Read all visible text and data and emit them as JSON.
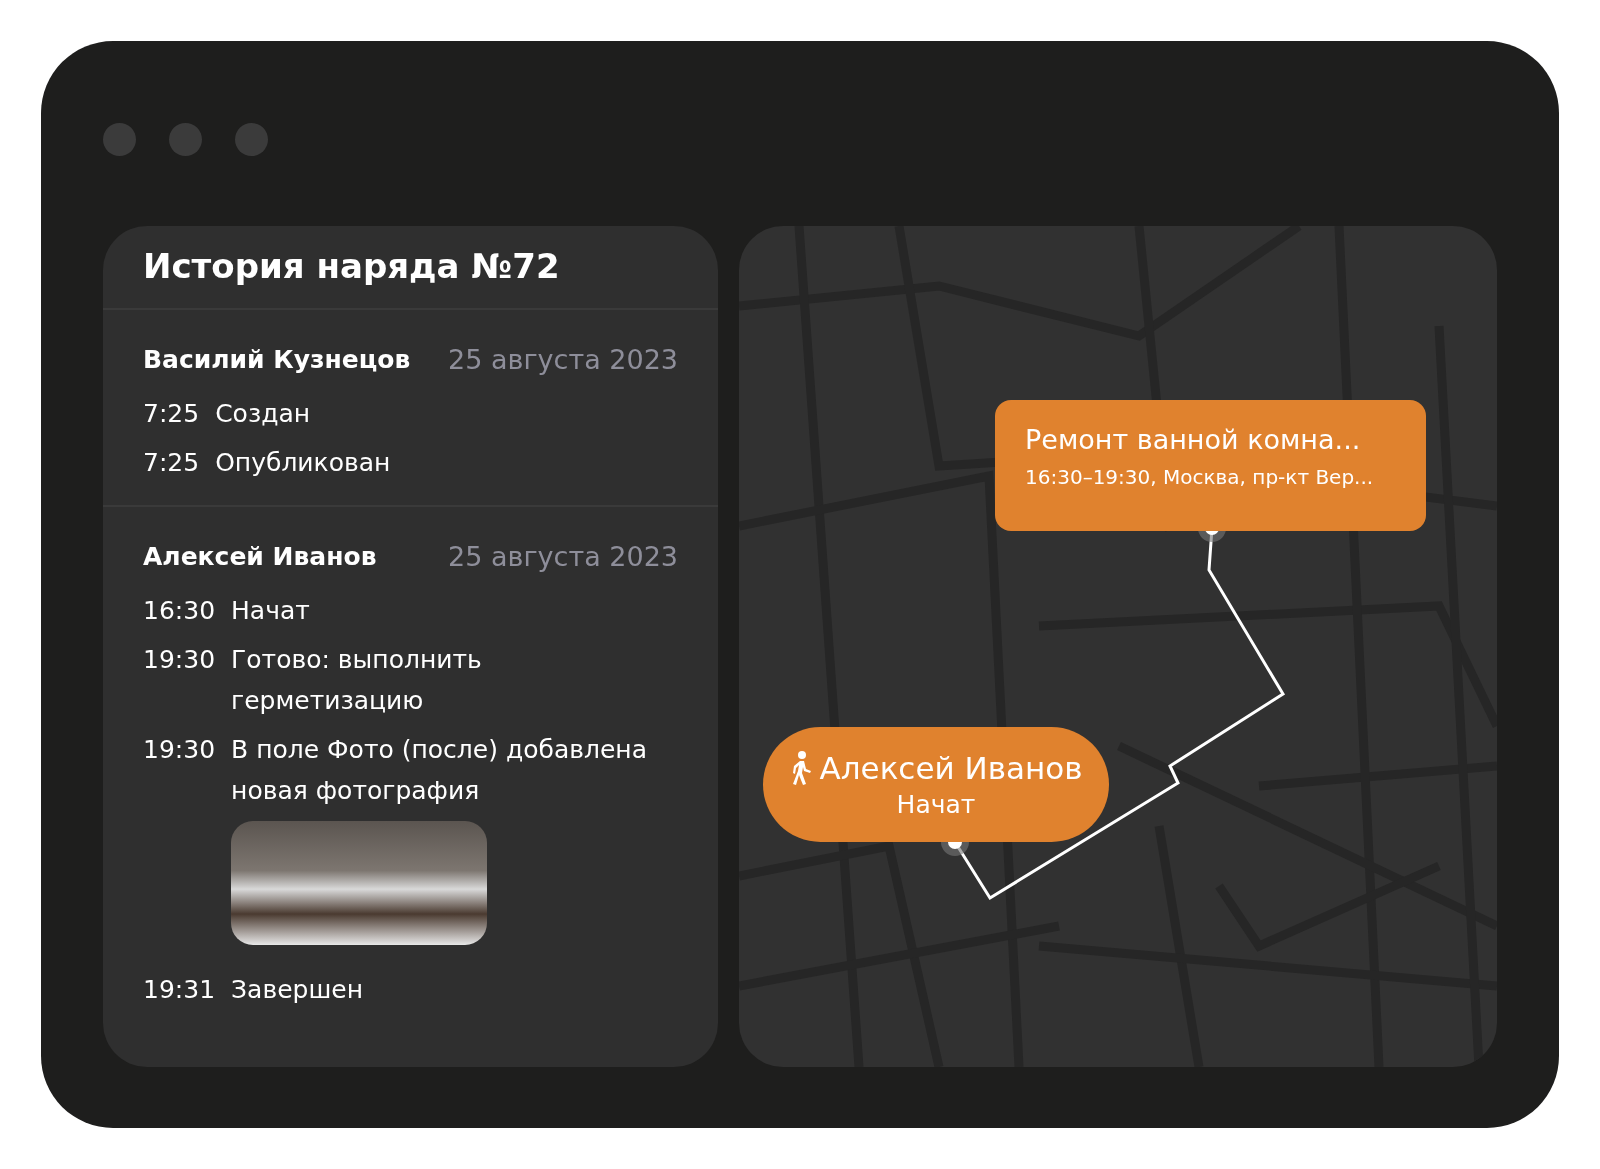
{
  "history": {
    "title": "История наряда №72",
    "groups": [
      {
        "author": "Василий Кузнецов",
        "date": "25 августа 2023",
        "events": [
          {
            "time": "7:25",
            "text": "Создан",
            "photo": false
          },
          {
            "time": "7:25",
            "text": "Опубликован",
            "photo": false
          }
        ]
      },
      {
        "author": "Алексей Иванов",
        "date": "25 августа 2023",
        "events": [
          {
            "time": "16:30",
            "text": "Начат",
            "photo": false
          },
          {
            "time": "19:30",
            "text": "Готово: выполнить герметизацию",
            "photo": false
          },
          {
            "time": "19:30",
            "text": "В поле Фото (после) добавлена новая фотография",
            "photo": true
          },
          {
            "time": "19:31",
            "text": "Завершен",
            "photo": false
          }
        ]
      }
    ]
  },
  "map": {
    "job_card": {
      "title": "Ремонт ванной комна...",
      "subtitle": "16:30–19:30, Москва, пр-кт Вер..."
    },
    "worker_card": {
      "name": "Алексей Иванов",
      "status": "Начат"
    }
  }
}
